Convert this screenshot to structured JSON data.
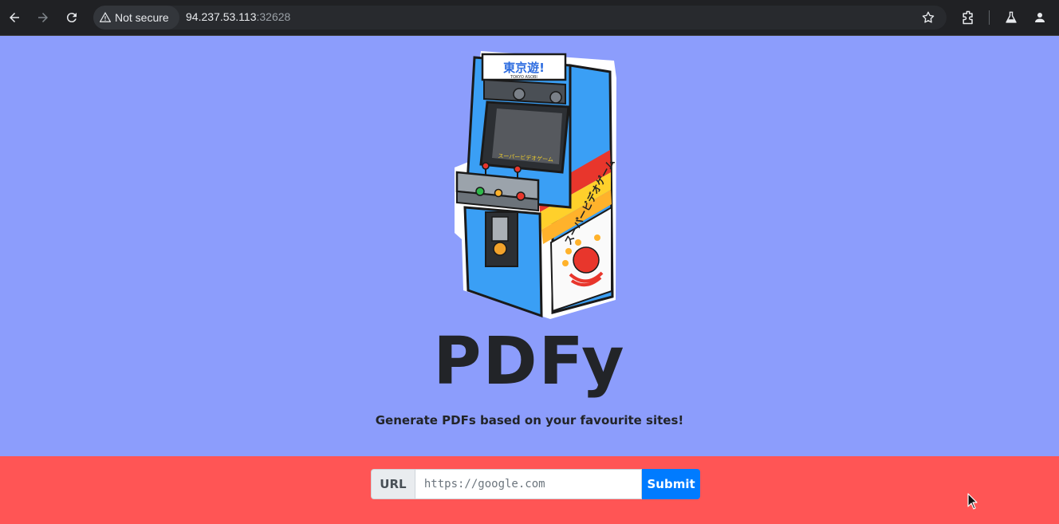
{
  "browser": {
    "security_label": "Not secure",
    "url_host": "94.237.53.113",
    "url_port": ":32628",
    "icons": [
      "back-arrow-icon",
      "forward-arrow-icon",
      "reload-icon",
      "warning-icon",
      "star-icon",
      "extensions-icon",
      "labs-flask-icon",
      "profile-icon"
    ]
  },
  "page": {
    "title": "PDFy",
    "subtitle": "Generate PDFs based on your favourite sites!",
    "logo": {
      "marquee_text": "東京遊!",
      "marquee_sub": "TOKYO ASOBI",
      "screen_text": "スーパービデオゲーム",
      "side_text": "スーパービデオゲーム"
    }
  },
  "form": {
    "label": "URL",
    "placeholder": "https://google.com",
    "value": "",
    "submit_label": "Submit"
  },
  "colors": {
    "hero_bg": "#8c9dfc",
    "form_bg": "#ff5555",
    "submit_bg": "#007bff",
    "chrome_bg": "#202124"
  }
}
